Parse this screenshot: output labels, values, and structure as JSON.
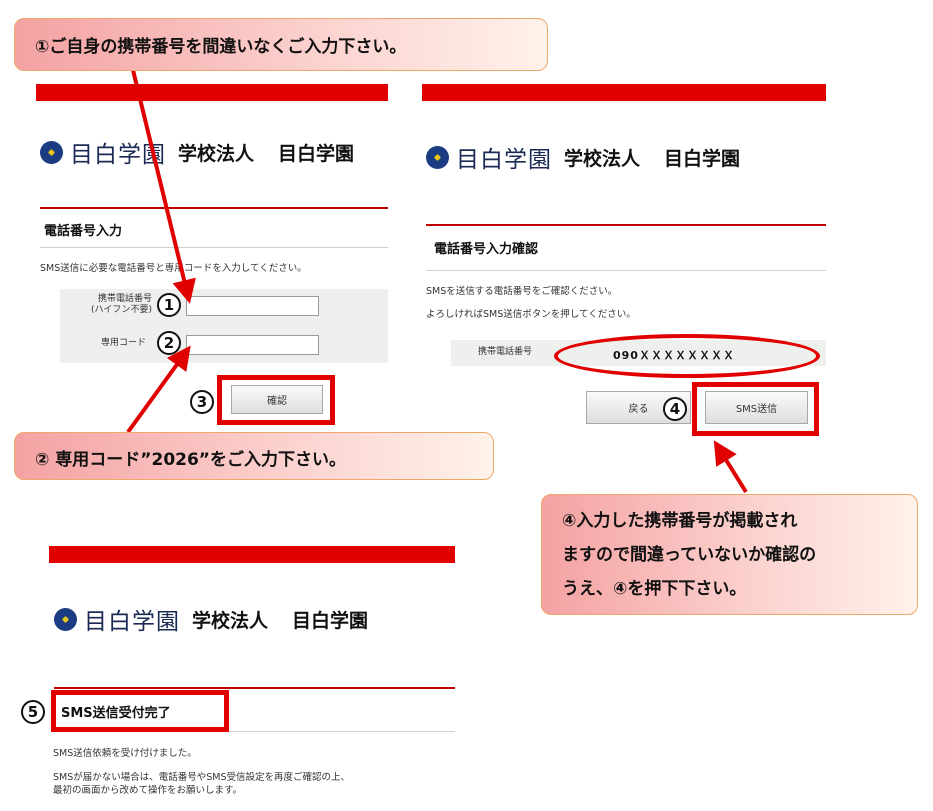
{
  "callouts": {
    "step1": "①ご自身の携帯番号を間違いなくご入力下さい。",
    "step2": "②  専用コード”2026”をご入力下さい。",
    "step4_lines": [
      "④入力した携帯番号が掲載され",
      "ますので間違っていないか確認の",
      "うえ、④を押下下さい。"
    ]
  },
  "logo": {
    "name": "目白学園",
    "corp": "学校法人",
    "corp_name": "目白学園"
  },
  "screen1": {
    "title": "電話番号入力",
    "instruction": "SMS送信に必要な電話番号と専用コードを入力してください。",
    "phone_label_1": "携帯電話番号",
    "phone_label_2": "(ハイフン不要)",
    "code_label": "専用コード",
    "phone_value": "",
    "code_value": "",
    "confirm_button": "確認"
  },
  "screen2": {
    "title": "電話番号入力確認",
    "line1": "SMSを送信する電話番号をご確認ください。",
    "line2": "よろしければSMS送信ボタンを押してください。",
    "phone_label": "携帯電話番号",
    "phone_value": "090ＸＸＸＸＸＸＸＸ",
    "back_button": "戻る",
    "sms_button": "SMS送信"
  },
  "screen3": {
    "title": "SMS送信受付完了",
    "line1": "SMS送信依頼を受け付けました。",
    "line2": "SMSが届かない場合は、電話番号やSMS受信設定を再度ご確認の上、",
    "line3": "最初の画面から改めて操作をお願いします。"
  },
  "markers": {
    "m1": "1",
    "m2": "2",
    "m3": "3",
    "m4": "4",
    "m5": "5"
  },
  "colors": {
    "accent_red": "#e00000",
    "logo_navy": "#1b3c82",
    "callout_pink": "#f4a2a2"
  }
}
